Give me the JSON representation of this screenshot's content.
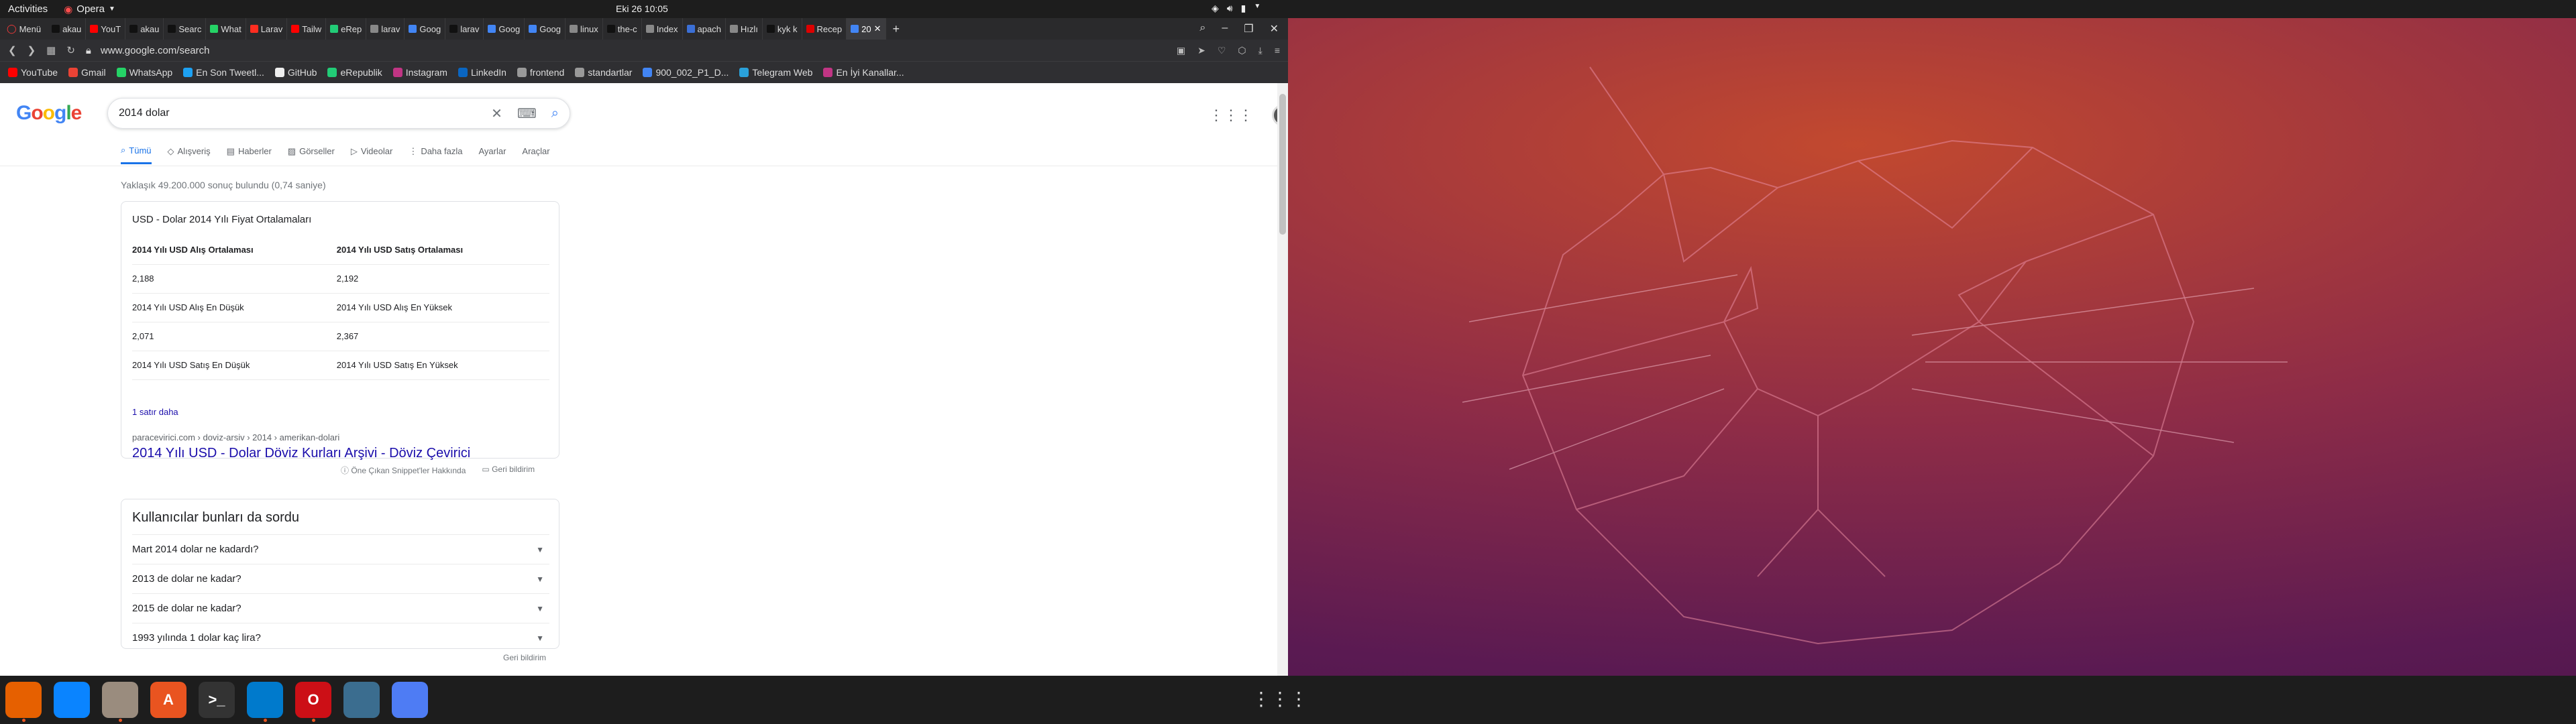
{
  "desktop": {
    "topbar": {
      "activities": "Activities",
      "app_name": "Opera",
      "clock": "Eki 26  10:05"
    },
    "colors": {
      "wallpaper_accent": "#c2492f",
      "wallpaper_dark": "#3c0f3f",
      "ubuntu_orange": "#e95420",
      "google_blue": "#1a73e8"
    }
  },
  "browser": {
    "menu_label": "Menü",
    "tabs": [
      {
        "label": "akau",
        "color": "#111"
      },
      {
        "label": "YouT",
        "color": "#ff0000"
      },
      {
        "label": "akau",
        "color": "#111"
      },
      {
        "label": "Searc",
        "color": "#111"
      },
      {
        "label": "What",
        "color": "#25d366"
      },
      {
        "label": "Larav",
        "color": "#ff2d20"
      },
      {
        "label": "Tailw",
        "color": "#ff0000"
      },
      {
        "label": "eRep",
        "color": "#2c7"
      },
      {
        "label": "larav",
        "color": "#888"
      },
      {
        "label": "Goog",
        "color": "#4285f4"
      },
      {
        "label": "larav",
        "color": "#111"
      },
      {
        "label": "Goog",
        "color": "#4285f4"
      },
      {
        "label": "Goog",
        "color": "#4285f4"
      },
      {
        "label": "linux",
        "color": "#888"
      },
      {
        "label": "the-c",
        "color": "#111"
      },
      {
        "label": "Index",
        "color": "#888"
      },
      {
        "label": "apach",
        "color": "#3b6fd6"
      },
      {
        "label": "Hızlı",
        "color": "#888"
      },
      {
        "label": "kyk k",
        "color": "#111"
      },
      {
        "label": "Recep",
        "color": "#d00"
      },
      {
        "label": "20",
        "color": "#4285f4",
        "active": true
      }
    ],
    "new_tab": "+",
    "url": "www.google.com/search",
    "bookmarks": [
      {
        "label": "YouTube",
        "color": "#ff0000"
      },
      {
        "label": "Gmail",
        "color": "#ea4335"
      },
      {
        "label": "WhatsApp",
        "color": "#25d366"
      },
      {
        "label": "En Son Tweetl...",
        "color": "#1da1f2"
      },
      {
        "label": "GitHub",
        "color": "#eeeeee"
      },
      {
        "label": "eRepublik",
        "color": "#2c7"
      },
      {
        "label": "Instagram",
        "color": "#c13584"
      },
      {
        "label": "LinkedIn",
        "color": "#0a66c2"
      },
      {
        "label": "frontend",
        "color": "#999999"
      },
      {
        "label": "standartlar",
        "color": "#999999"
      },
      {
        "label": "900_002_P1_D...",
        "color": "#4285f4"
      },
      {
        "label": "Telegram Web",
        "color": "#2aa1da"
      },
      {
        "label": "En İyi Kanallar...",
        "color": "#c13584"
      }
    ]
  },
  "google": {
    "logo": "Google",
    "query": "2014 dolar",
    "tabs": [
      {
        "label": "Tümü",
        "icon": "search-icon",
        "active": true
      },
      {
        "label": "Alışveriş",
        "icon": "tag-icon"
      },
      {
        "label": "Haberler",
        "icon": "news-icon"
      },
      {
        "label": "Görseller",
        "icon": "image-icon"
      },
      {
        "label": "Videolar",
        "icon": "video-icon"
      },
      {
        "label": "Daha fazla",
        "icon": "more-icon"
      },
      {
        "label": "Ayarlar"
      },
      {
        "label": "Araçlar"
      }
    ],
    "result_stats": "Yaklaşık 49.200.000 sonuç bulundu (0,74 saniye)",
    "snippet": {
      "title": "USD - Dolar 2014 Yılı Fiyat Ortalamaları",
      "rows": [
        {
          "c1": "2014 Yılı USD Alış Ortalaması",
          "c2": "2014 Yılı USD Satış Ortalaması",
          "header": true
        },
        {
          "c1": "2,188",
          "c2": "2,192"
        },
        {
          "c1": "2014 Yılı USD Alış En Düşük",
          "c2": "2014 Yılı USD Alış En Yüksek"
        },
        {
          "c1": "2,071",
          "c2": "2,367"
        },
        {
          "c1": "2014 Yılı USD Satış En Düşük",
          "c2": "2014 Yılı USD Satış En Yüksek"
        }
      ],
      "more_rows": "1 satır daha",
      "cite": "paracevirici.com › doviz-arsiv › 2014 › amerikan-dolari",
      "link": "2014 Yılı USD - Dolar Döviz Kurları Arşivi - Döviz Çevirici",
      "about": "Öne Çıkan Snippet'ler Hakkında",
      "feedback": "Geri bildirim"
    },
    "paa": {
      "title": "Kullanıcılar bunları da sordu",
      "items": [
        "Mart 2014 dolar ne kadardı?",
        "2013 de dolar ne kadar?",
        "2015 de dolar ne kadar?",
        "1993 yılında 1 dolar kaç lira?"
      ],
      "feedback": "Geri bildirim"
    }
  },
  "dock": {
    "apps": [
      {
        "name": "firefox",
        "label": "",
        "color": "#e66000",
        "running": true
      },
      {
        "name": "thunderbird",
        "label": "",
        "color": "#0a84ff",
        "running": false
      },
      {
        "name": "files",
        "label": "",
        "color": "#9a8c7e",
        "running": true
      },
      {
        "name": "software",
        "label": "A",
        "color": "#e95420",
        "running": false
      },
      {
        "name": "terminal",
        "label": ">_",
        "color": "#333",
        "running": false
      },
      {
        "name": "vscode",
        "label": "",
        "color": "#007acc",
        "running": true
      },
      {
        "name": "opera",
        "label": "O",
        "color": "#cc0f16",
        "running": true
      },
      {
        "name": "mysql-workbench",
        "label": "",
        "color": "#3b6d8f",
        "running": false
      },
      {
        "name": "screenshot",
        "label": "",
        "color": "#4e7cf4",
        "running": false
      }
    ],
    "show_apps": "⋮⋮⋮"
  }
}
